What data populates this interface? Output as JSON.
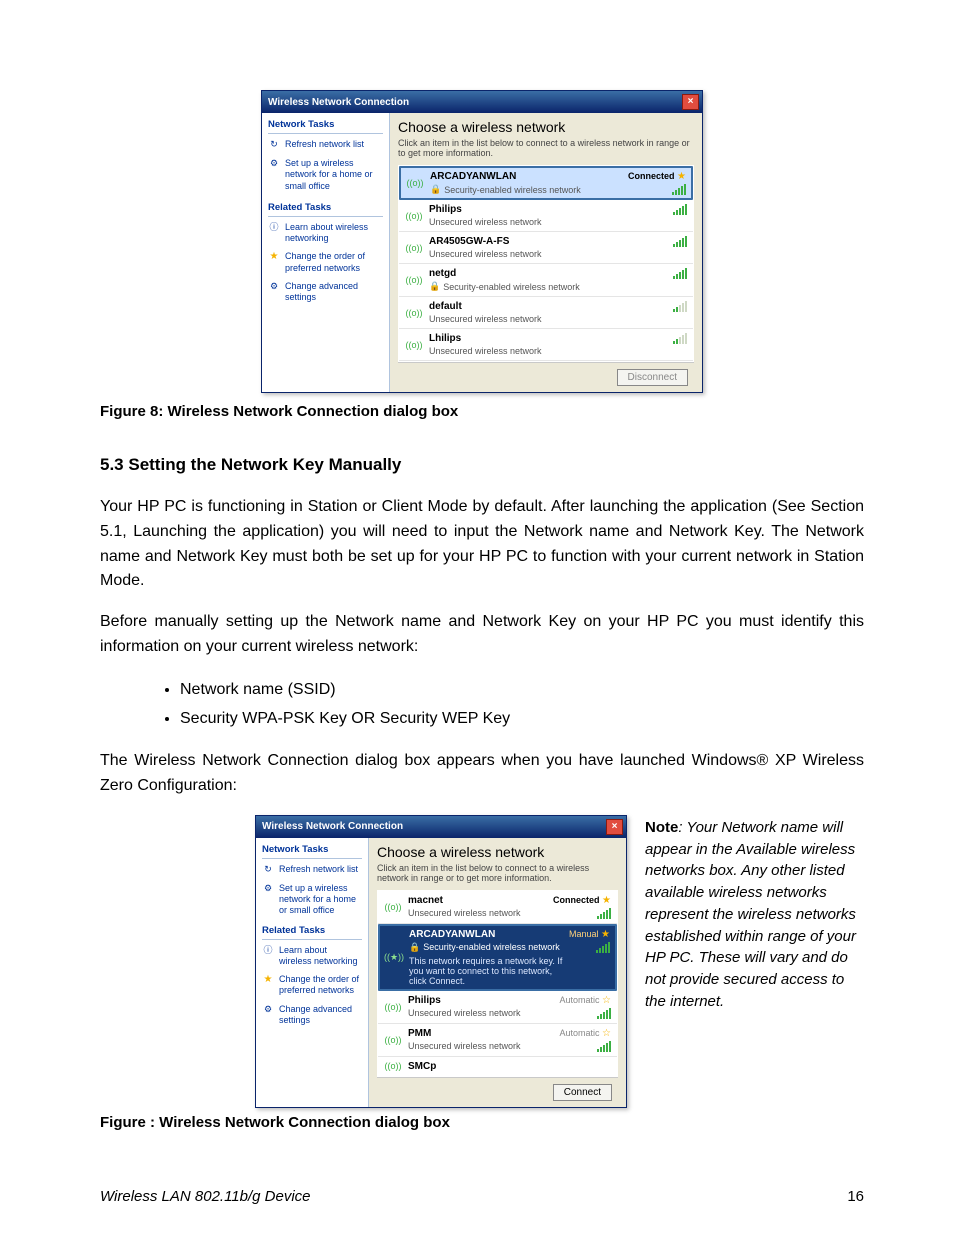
{
  "dialog_common": {
    "title": "Wireless Network Connection",
    "close": "×",
    "choose_heading": "Choose a wireless network",
    "instruction": "Click an item in the list below to connect to a wireless network in range or to get more information.",
    "side_heading1": "Network Tasks",
    "side_heading2": "Related Tasks",
    "tasks": {
      "refresh": "Refresh network list",
      "setup": "Set up a wireless network for a home or small office",
      "learn": "Learn about wireless networking",
      "order": "Change the order of preferred networks",
      "advanced": "Change advanced settings"
    },
    "sec_enabled": "Security-enabled wireless network",
    "unsecured": "Unsecured wireless network"
  },
  "dialog1": {
    "list": [
      {
        "ssid": "ARCADYANWLAN",
        "type": "secure",
        "status": "Connected",
        "star": true,
        "selected": true
      },
      {
        "ssid": "Philips",
        "type": "unsecure"
      },
      {
        "ssid": "AR4505GW-A-FS",
        "type": "unsecure"
      },
      {
        "ssid": "netgd",
        "type": "secure"
      },
      {
        "ssid": "default",
        "type": "unsecure",
        "weak": true
      },
      {
        "ssid": "Lhilips",
        "type": "unsecure",
        "weak": true
      }
    ],
    "button": "Disconnect"
  },
  "dialog2": {
    "list": [
      {
        "ssid": "macnet",
        "type": "unsecure",
        "status": "Connected",
        "star": true
      },
      {
        "ssid": "ARCADYANWLAN",
        "type": "secure",
        "status": "Manual",
        "star": true,
        "selected_dark": true,
        "extra": "This network requires a network key. If you want to connect to this network, click Connect."
      },
      {
        "ssid": "Philips",
        "type": "unsecure",
        "status": "Automatic",
        "star": true
      },
      {
        "ssid": "PMM",
        "type": "unsecure",
        "status": "Automatic",
        "star": true
      },
      {
        "ssid": "SMCp",
        "type": "",
        "partial": true
      }
    ],
    "button": "Connect"
  },
  "captions": {
    "fig8": "Figure 8: Wireless Network Connection dialog box",
    "fig_": "Figure : Wireless Network Connection dialog box"
  },
  "section_heading": "5.3   Setting the Network Key Manually",
  "para1": "Your HP PC is functioning in Station or Client Mode by default.  After launching the application (See Section 5.1, Launching the application) you will need to input the Network name and Network Key. The Network name and Network Key must both be set up for your HP PC to function with your current network in Station Mode.",
  "para2": "Before manually setting up the Network name and Network Key on your HP PC you must identify this information on your current wireless network:",
  "bullets": {
    "b1": "Network name (SSID)",
    "b2": "Security WPA-PSK Key OR Security WEP Key"
  },
  "para3": "The Wireless Network Connection dialog box appears when you have launched Windows® XP Wireless Zero Configuration:",
  "note_label": "Note",
  "note_text": ": Your Network name will appear in the Available wireless networks box.  Any other listed available wireless networks represent the wireless networks established within range of your HP PC. These will vary and do not provide secured access to the internet.",
  "footer_left": "Wireless LAN 802.11b/g Device",
  "footer_right": "16"
}
